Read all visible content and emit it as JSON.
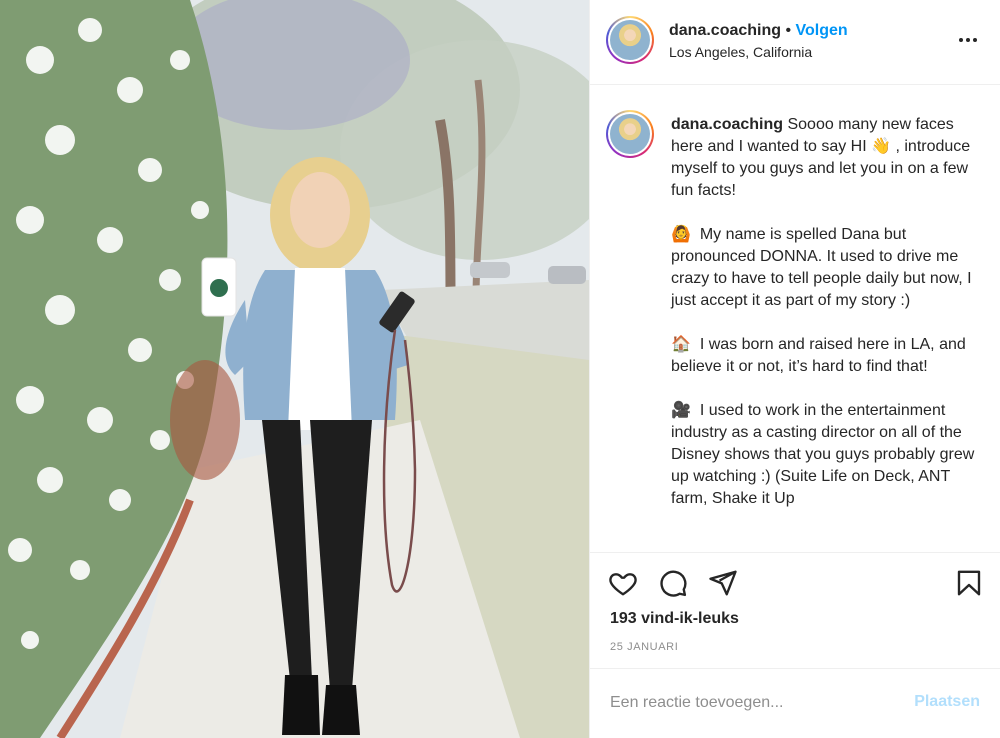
{
  "post": {
    "username": "dana.coaching",
    "separator": "•",
    "follow_label": "Volgen",
    "location": "Los Angeles, California",
    "caption_username": "dana.coaching",
    "caption_text": " Soooo many new faces here and I wanted to say HI 👋 , introduce myself to you guys and let you in on a few fun facts!\n\n🙆  My name is spelled Dana but pronounced DONNA. It used to drive me crazy to have to tell people daily but now, I just accept it as part of my story :)\n\n🏠  I was born and raised here in LA, and believe it or not, it’s hard to find that!\n\n🎥  I used to work in the entertainment industry as a casting director on all of the Disney shows that you guys probably grew up watching :) (Suite Life on Deck, ANT farm, Shake it Up",
    "likes": "193 vind-ik-leuks",
    "date": "25 JANUARI"
  },
  "comment_box": {
    "placeholder": "Een reactie toevoegen...",
    "post_label": "Plaatsen"
  },
  "icons": {
    "more": "more-horizontal-icon",
    "like": "heart-icon",
    "comment": "comment-icon",
    "share": "paper-plane-icon",
    "save": "bookmark-icon"
  },
  "colors": {
    "accent": "#0095f6",
    "post_disabled": "#b2dffc",
    "muted": "#8e8e8e"
  }
}
